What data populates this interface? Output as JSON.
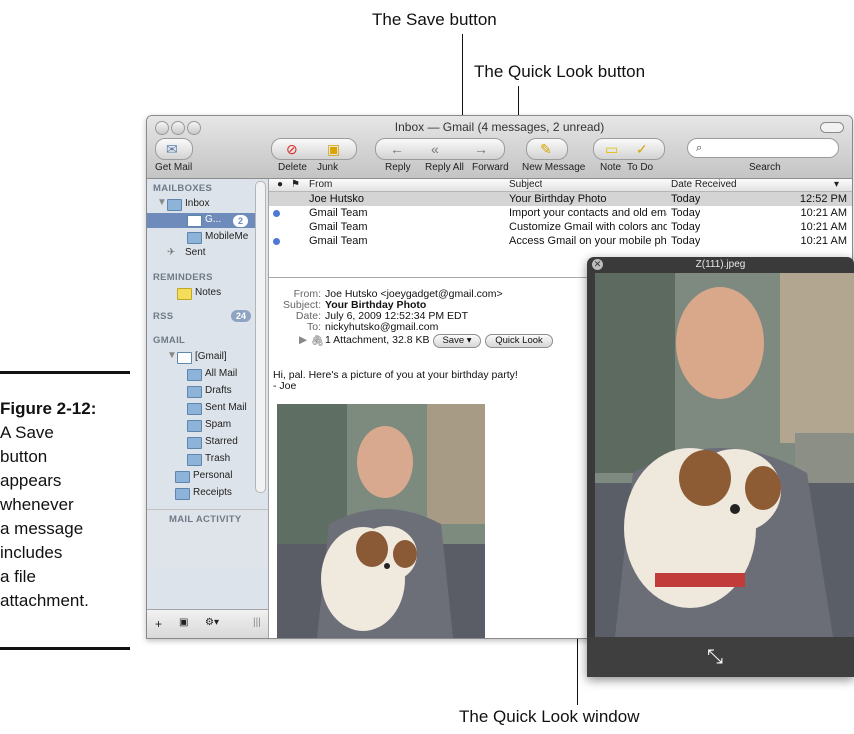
{
  "callouts": {
    "save_button": "The Save button",
    "quick_look_button": "The Quick Look button",
    "quick_look_window": "The Quick Look window"
  },
  "figure": {
    "label": "Figure 2-12:",
    "caption_lines": [
      "A Save",
      "button",
      "appears",
      "whenever",
      "a message",
      "includes",
      "a file",
      "attachment."
    ]
  },
  "window": {
    "title": "Inbox — Gmail (4 messages, 2 unread)",
    "toolbar": {
      "get_mail": "Get Mail",
      "delete": "Delete",
      "junk": "Junk",
      "reply": "Reply",
      "reply_all": "Reply All",
      "forward": "Forward",
      "new_message": "New Message",
      "note": "Note",
      "to_do": "To Do",
      "search": "Search",
      "search_placeholder": ""
    },
    "sidebar": {
      "mailboxes_header": "MAILBOXES",
      "inbox": "Inbox",
      "inbox_account": "G...",
      "inbox_account_badge": "2",
      "mobileme": "MobileMe",
      "sent": "Sent",
      "reminders_header": "REMINDERS",
      "notes": "Notes",
      "rss_header": "RSS",
      "rss_badge": "24",
      "gmail_header": "GMAIL",
      "gmail_root": "[Gmail]",
      "all_mail": "All Mail",
      "drafts": "Drafts",
      "sent_mail": "Sent Mail",
      "spam": "Spam",
      "starred": "Starred",
      "trash": "Trash",
      "personal": "Personal",
      "receipts": "Receipts",
      "mail_activity": "MAIL ACTIVITY"
    },
    "message_list": {
      "columns": {
        "from": "From",
        "subject": "Subject",
        "date": "Date Received"
      },
      "rows": [
        {
          "unread": false,
          "from": "Joe Hutsko",
          "subject": "Your Birthday Photo",
          "date": "Today",
          "time": "12:52 PM"
        },
        {
          "unread": true,
          "from": "Gmail Team",
          "subject": "Import your contacts and old email",
          "date": "Today",
          "time": "10:21 AM"
        },
        {
          "unread": false,
          "from": "Gmail Team",
          "subject": "Customize Gmail with colors and t...",
          "date": "Today",
          "time": "10:21 AM"
        },
        {
          "unread": true,
          "from": "Gmail Team",
          "subject": "Access Gmail on your mobile phone",
          "date": "Today",
          "time": "10:21 AM"
        }
      ]
    },
    "message": {
      "from_label": "From:",
      "from": "Joe Hutsko <joeygadget@gmail.com>",
      "subject_label": "Subject:",
      "subject": "Your Birthday Photo",
      "date_label": "Date:",
      "date": "July 6, 2009 12:52:34 PM EDT",
      "to_label": "To:",
      "to": "nickyhutsko@gmail.com",
      "attachment": "1 Attachment, 32.8 KB",
      "save_button": "Save ▾",
      "quick_look_button": "Quick Look",
      "body_line1": "Hi, pal. Here's a picture of you at your birthday party!",
      "body_line2": "- Joe"
    }
  },
  "quick_look": {
    "title": "Z(111).jpeg"
  }
}
